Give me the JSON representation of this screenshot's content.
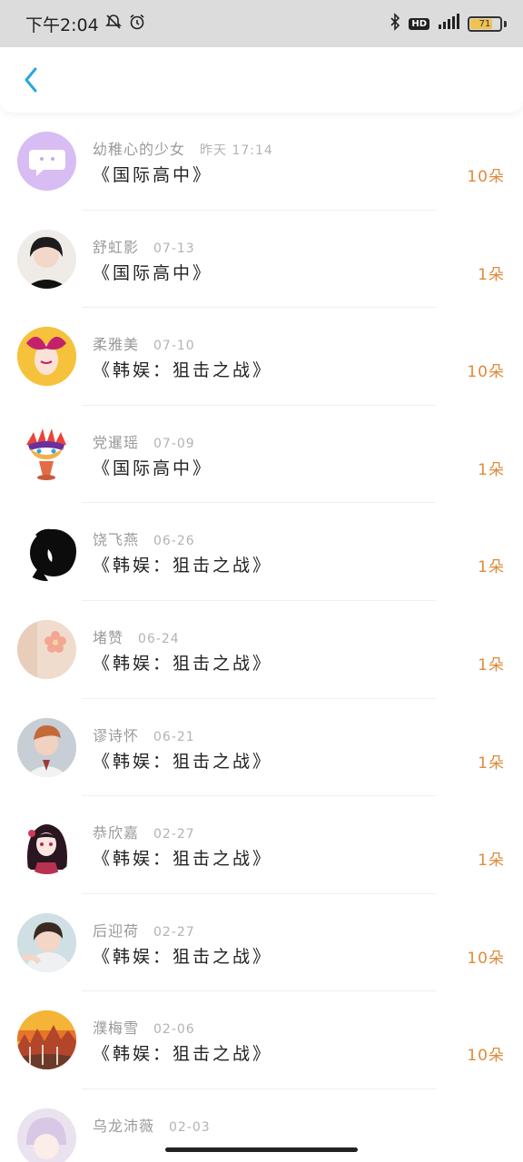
{
  "status_bar": {
    "time": "下午2:04",
    "battery": "71",
    "battery_level": 0.71,
    "hd": "HD"
  },
  "header": {
    "back_icon": "chevron-left-icon",
    "accent_color": "#2ba6de"
  },
  "records": [
    {
      "name": "幼稚心的少女",
      "date": "昨天 17:14",
      "title": "《国际高中》",
      "amount": "10朵",
      "avatar": "chat-bubble-avatar"
    },
    {
      "name": "舒虹影",
      "date": "07-13",
      "title": "《国际高中》",
      "amount": "1朵",
      "avatar": "girl-photo-avatar"
    },
    {
      "name": "柔雅美",
      "date": "07-10",
      "title": "《韩娱：狙击之战》",
      "amount": "10朵",
      "avatar": "illustration-avatar"
    },
    {
      "name": "党暹瑶",
      "date": "07-09",
      "title": "《国际高中》",
      "amount": "1朵",
      "avatar": "mask-avatar"
    },
    {
      "name": "饶飞燕",
      "date": "06-26",
      "title": "《韩娱：狙击之战》",
      "amount": "1朵",
      "avatar": "silhouette-avatar"
    },
    {
      "name": "堵赞",
      "date": "06-24",
      "title": "《韩娱：狙击之战》",
      "amount": "1朵",
      "avatar": "flower-avatar"
    },
    {
      "name": "谬诗怀",
      "date": "06-21",
      "title": "《韩娱：狙击之战》",
      "amount": "1朵",
      "avatar": "boy-photo-avatar"
    },
    {
      "name": "恭欣嘉",
      "date": "02-27",
      "title": "《韩娱：狙击之战》",
      "amount": "1朵",
      "avatar": "anime-girl-avatar"
    },
    {
      "name": "后迎荷",
      "date": "02-27",
      "title": "《韩娱：狙击之战》",
      "amount": "10朵",
      "avatar": "portrait-photo-avatar"
    },
    {
      "name": "濮梅雪",
      "date": "02-06",
      "title": "《韩娱：狙击之战》",
      "amount": "10朵",
      "avatar": "landscape-avatar"
    },
    {
      "name": "乌龙沛薇",
      "date": "02-03",
      "title": "",
      "amount": "",
      "avatar": "anime-avatar"
    }
  ]
}
